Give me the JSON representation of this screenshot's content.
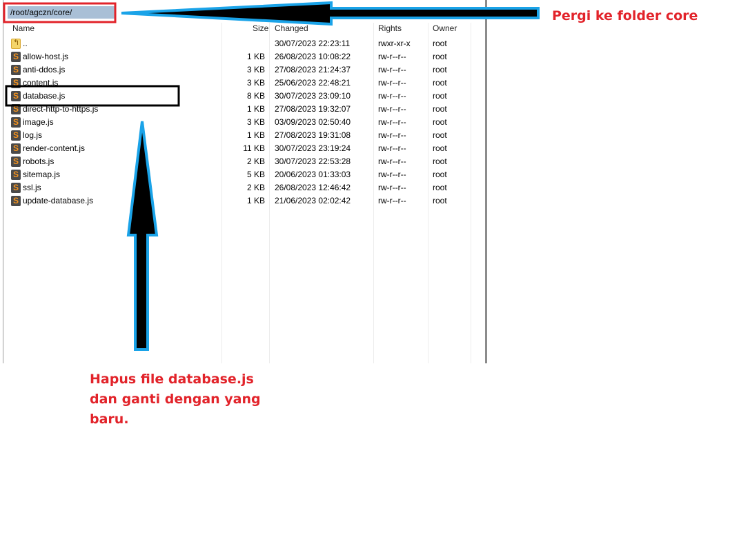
{
  "path_bar": {
    "path": "/root/agczn/core/"
  },
  "columns": {
    "name": "Name",
    "size": "Size",
    "changed": "Changed",
    "rights": "Rights",
    "owner": "Owner"
  },
  "files": [
    {
      "name": "..",
      "size": "",
      "changed": "30/07/2023 22:23:11",
      "rights": "rwxr-xr-x",
      "owner": "root",
      "icon": "parent-folder-icon"
    },
    {
      "name": "allow-host.js",
      "size": "1 KB",
      "changed": "26/08/2023 10:08:22",
      "rights": "rw-r--r--",
      "owner": "root",
      "icon": "sublime-file-icon"
    },
    {
      "name": "anti-ddos.js",
      "size": "3 KB",
      "changed": "27/08/2023 21:24:37",
      "rights": "rw-r--r--",
      "owner": "root",
      "icon": "sublime-file-icon"
    },
    {
      "name": "content.js",
      "size": "3 KB",
      "changed": "25/06/2023 22:48:21",
      "rights": "rw-r--r--",
      "owner": "root",
      "icon": "sublime-file-icon"
    },
    {
      "name": "database.js",
      "size": "8 KB",
      "changed": "30/07/2023 23:09:10",
      "rights": "rw-r--r--",
      "owner": "root",
      "icon": "sublime-file-icon"
    },
    {
      "name": "direct-http-to-https.js",
      "size": "1 KB",
      "changed": "27/08/2023 19:32:07",
      "rights": "rw-r--r--",
      "owner": "root",
      "icon": "sublime-file-icon"
    },
    {
      "name": "image.js",
      "size": "3 KB",
      "changed": "03/09/2023 02:50:40",
      "rights": "rw-r--r--",
      "owner": "root",
      "icon": "sublime-file-icon"
    },
    {
      "name": "log.js",
      "size": "1 KB",
      "changed": "27/08/2023 19:31:08",
      "rights": "rw-r--r--",
      "owner": "root",
      "icon": "sublime-file-icon"
    },
    {
      "name": "render-content.js",
      "size": "11 KB",
      "changed": "30/07/2023 23:19:24",
      "rights": "rw-r--r--",
      "owner": "root",
      "icon": "sublime-file-icon"
    },
    {
      "name": "robots.js",
      "size": "2 KB",
      "changed": "30/07/2023 22:53:28",
      "rights": "rw-r--r--",
      "owner": "root",
      "icon": "sublime-file-icon"
    },
    {
      "name": "sitemap.js",
      "size": "5 KB",
      "changed": "20/06/2023 01:33:03",
      "rights": "rw-r--r--",
      "owner": "root",
      "icon": "sublime-file-icon"
    },
    {
      "name": "ssl.js",
      "size": "2 KB",
      "changed": "26/08/2023 12:46:42",
      "rights": "rw-r--r--",
      "owner": "root",
      "icon": "sublime-file-icon"
    },
    {
      "name": "update-database.js",
      "size": "1 KB",
      "changed": "21/06/2023 02:02:42",
      "rights": "rw-r--r--",
      "owner": "root",
      "icon": "sublime-file-icon"
    }
  ],
  "annotations": {
    "goto_core": "Pergi ke folder core",
    "delete_db": [
      "Hapus file database.js",
      "dan ganti dengan yang",
      "baru."
    ]
  },
  "colors": {
    "annotation_red": "#e2232a",
    "arrow_outline": "#1aa3e8",
    "path_highlight": "#a9bfd6"
  }
}
